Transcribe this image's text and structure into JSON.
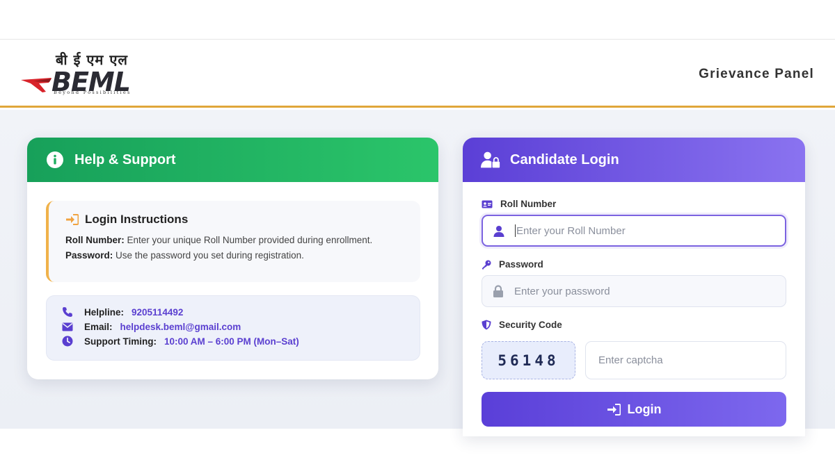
{
  "header": {
    "logo_hindi": "बी ई एम एल",
    "logo_text": "BEML",
    "logo_tagline": "Beyond Possibilities",
    "title": "Grievance Panel"
  },
  "help": {
    "title": "Help & Support",
    "instructions_title": "Login Instructions",
    "roll_label": "Roll Number:",
    "roll_text": "Enter your unique Roll Number provided during enrollment.",
    "password_label": "Password:",
    "password_text": "Use the password you set during registration.",
    "helpline_label": "Helpline:",
    "helpline_value": "9205114492",
    "email_label": "Email:",
    "email_value": "helpdesk.beml@gmail.com",
    "timing_label": "Support Timing:",
    "timing_value": "10:00 AM – 6:00 PM (Mon–Sat)"
  },
  "login": {
    "title": "Candidate Login",
    "roll_label": "Roll Number",
    "roll_placeholder": "Enter your Roll Number",
    "password_label": "Password",
    "password_placeholder": "Enter your password",
    "security_label": "Security Code",
    "captcha_code": "56148",
    "captcha_placeholder": "Enter captcha",
    "button_label": "Login"
  },
  "colors": {
    "green": "#17a05a",
    "purple": "#5b3fd6",
    "accent_orange": "#e0a63a",
    "logo_red": "#d8232a"
  },
  "icons": {
    "help_header": "info-circle-icon",
    "login_header": "user-lock-icon",
    "instructions": "sign-in-icon",
    "helpline": "phone-icon",
    "email": "envelope-icon",
    "timing": "clock-icon",
    "roll_label": "id-card-icon",
    "roll_input": "user-icon",
    "password_label": "key-icon",
    "password_input": "lock-icon",
    "security_label": "shield-icon",
    "login_button": "sign-in-icon"
  }
}
